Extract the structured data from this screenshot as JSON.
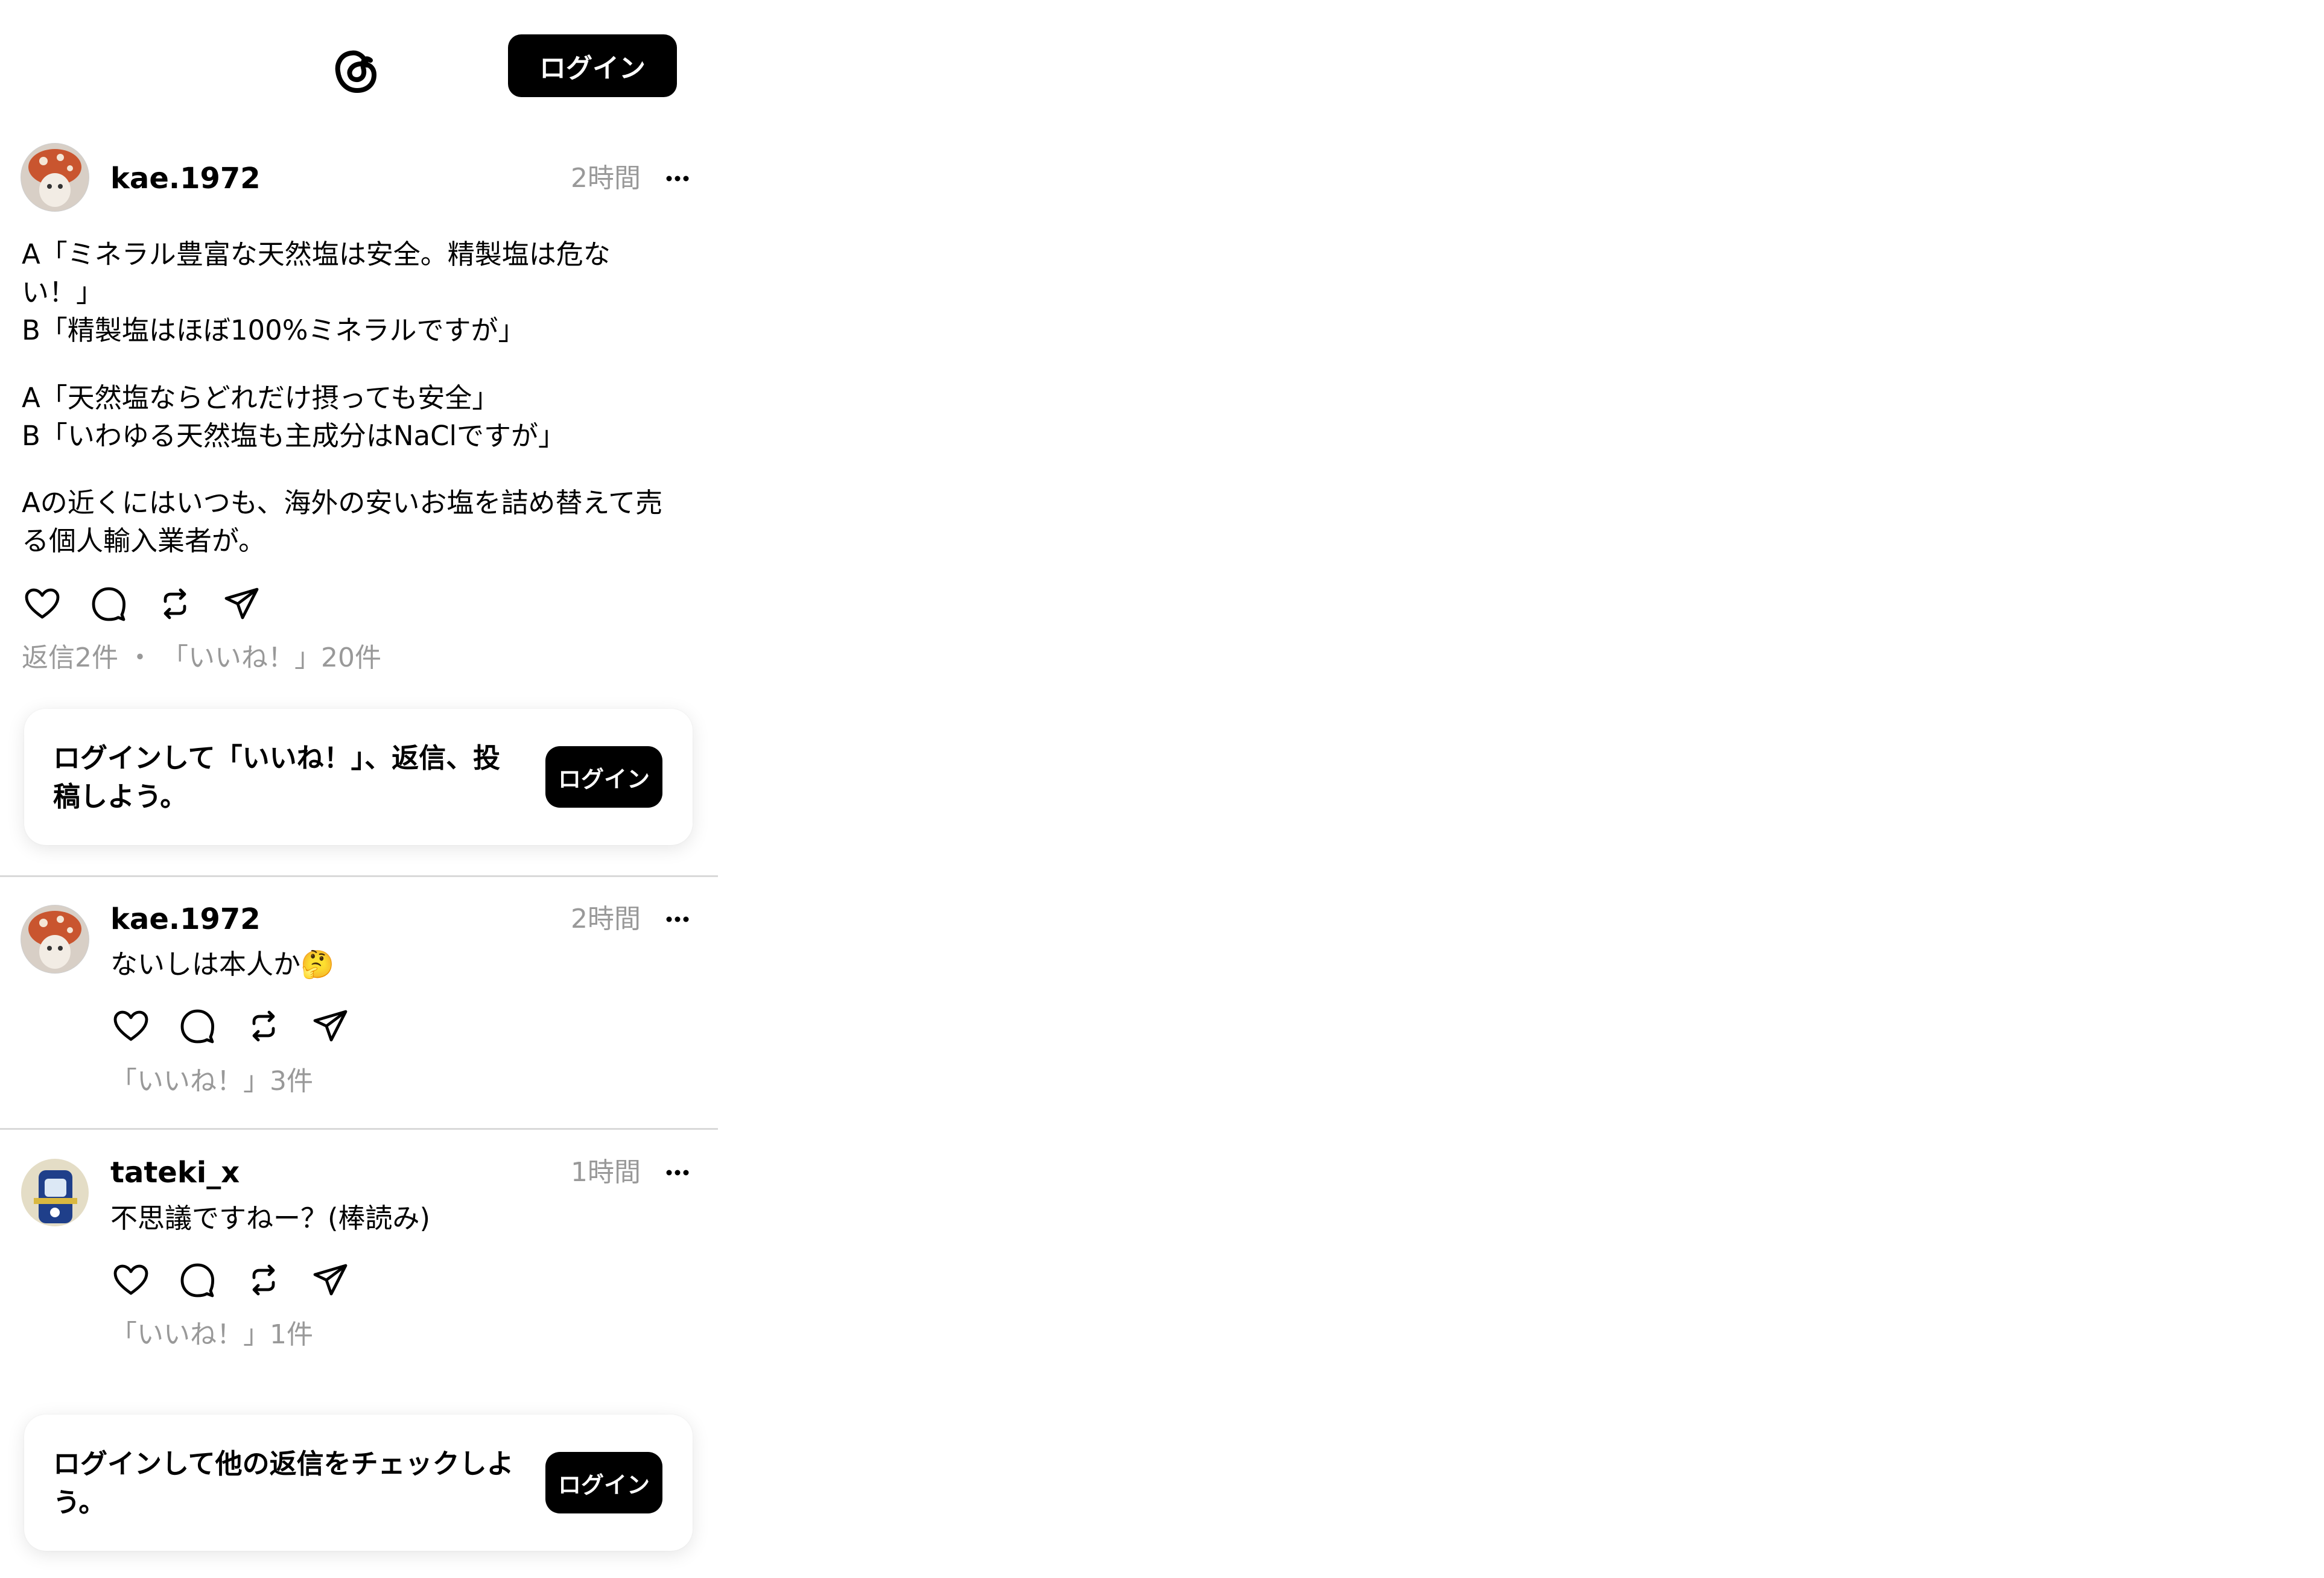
{
  "header": {
    "logo_icon": "threads-logo-icon",
    "login_label": "ログイン"
  },
  "main_post": {
    "username": "kae.1972",
    "time": "2時間",
    "lines": [
      "A「ミネラル豊富な天然塩は安全。精製塩は危な",
      "い！」",
      "B「精製塩はほぼ100%ミネラルですが」",
      "A「天然塩ならどれだけ摂っても安全」",
      "B「いわゆる天然塩も主成分はNaClですが」",
      "Aの近くにはいつも、海外の安いお塩を詰め替えて売",
      "る個人輸入業者が。"
    ],
    "stats": "返信2件 ・ 「いいね！」20件"
  },
  "cta_top": {
    "text": "ログインして「いいね！」、返信、投稿しよう。",
    "button_label": "ログイン"
  },
  "replies": [
    {
      "username": "kae.1972",
      "time": "2時間",
      "text": "ないしは本人か🤔",
      "stats": "「いいね！」3件"
    },
    {
      "username": "tateki_x",
      "time": "1時間",
      "text": "不思議ですねー？(棒読み)",
      "stats": "「いいね！」1件"
    }
  ],
  "cta_bottom": {
    "text": "ログインして他の返信をチェックしよう。",
    "button_label": "ログイン"
  },
  "icons": [
    "heart-icon",
    "comment-icon",
    "repost-icon",
    "share-icon",
    "more-icon"
  ],
  "colors": {
    "accent": "#000000",
    "muted_text": "#999999",
    "divider": "#d9d9d9"
  }
}
